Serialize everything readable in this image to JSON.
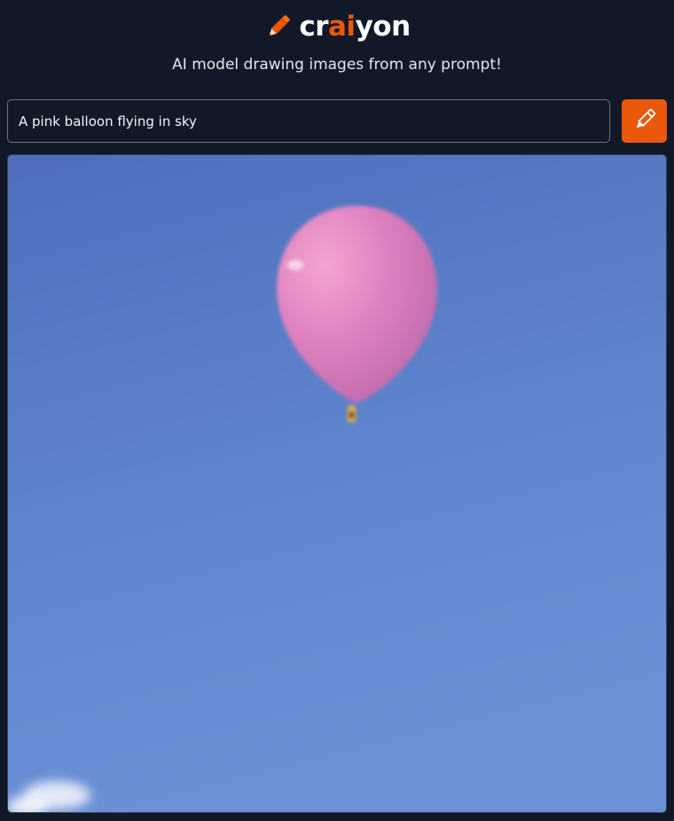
{
  "theme": {
    "accent": "#ea580c",
    "background": "#111827"
  },
  "header": {
    "logo_icon": "pencil-icon",
    "logo_parts": {
      "before": "cr",
      "accent": "ai",
      "after": "yon"
    }
  },
  "tagline": "AI model drawing images from any prompt!",
  "prompt": {
    "value": "A pink balloon flying in sky",
    "placeholder": ""
  },
  "draw_button": {
    "icon": "pencil-icon"
  },
  "result": {
    "image_subject": "pink balloon in blue sky"
  }
}
